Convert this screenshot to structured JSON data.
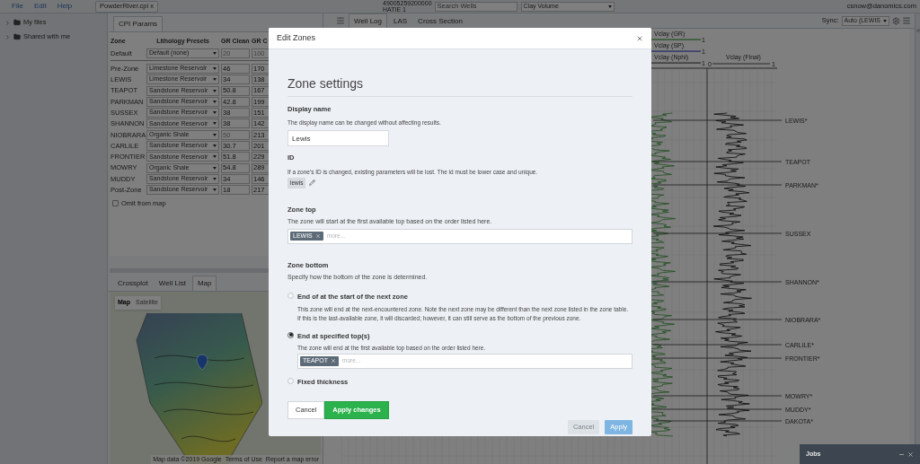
{
  "menu": [
    "File",
    "Edit",
    "Help"
  ],
  "file_tab": "PowderRiver.cpi x",
  "well": {
    "number": "49005259200000",
    "name": "HATIE 1"
  },
  "search": {
    "placeholder": "Search Wells"
  },
  "log_select": "Clay Volume",
  "user": "csnow@danomics.com",
  "sidebar": {
    "items": [
      {
        "label": "My files",
        "expanded": false
      },
      {
        "label": "Shared with me",
        "expanded": false
      }
    ]
  },
  "cpi_panel": {
    "tab": "CPI Params",
    "columns": [
      "Zone",
      "Lithology Presets",
      "GR Clean",
      "GR C"
    ],
    "default_row": {
      "zone": "Default",
      "preset": "Default (none)",
      "gr_clean": "20",
      "gr_clean_default": true,
      "gr_c": "100",
      "gr_c_default": true
    },
    "rows": [
      {
        "zone": "Pre-Zone",
        "preset": "Limestone Reservoir",
        "gr_clean": "46",
        "gr_clean_default": false,
        "gr_c": "170",
        "gr_c_default": false
      },
      {
        "zone": "LEWIS",
        "preset": "Limestone Reservoir",
        "gr_clean": "34",
        "gr_clean_default": false,
        "gr_c": "138",
        "gr_c_default": false
      },
      {
        "zone": "TEAPOT",
        "preset": "Sandstone Reservoir",
        "gr_clean": "50.8",
        "gr_clean_default": false,
        "gr_c": "167",
        "gr_c_default": false
      },
      {
        "zone": "PARKMAN",
        "preset": "Sandstone Reservoir",
        "gr_clean": "42.8",
        "gr_clean_default": false,
        "gr_c": "199",
        "gr_c_default": false
      },
      {
        "zone": "SUSSEX",
        "preset": "Sandstone Reservoir",
        "gr_clean": "38",
        "gr_clean_default": false,
        "gr_c": "151",
        "gr_c_default": false
      },
      {
        "zone": "SHANNON",
        "preset": "Sandstone Reservoir",
        "gr_clean": "38",
        "gr_clean_default": false,
        "gr_c": "142",
        "gr_c_default": false
      },
      {
        "zone": "NIOBRARA",
        "preset": "Organic Shale",
        "gr_clean": "50",
        "gr_clean_default": true,
        "gr_c": "213",
        "gr_c_default": false
      },
      {
        "zone": "CARLILE",
        "preset": "Sandstone Reservoir",
        "gr_clean": "30.7",
        "gr_clean_default": false,
        "gr_c": "201",
        "gr_c_default": false
      },
      {
        "zone": "FRONTIER",
        "preset": "Sandstone Reservoir",
        "gr_clean": "51.8",
        "gr_clean_default": false,
        "gr_c": "229",
        "gr_c_default": false
      },
      {
        "zone": "MOWRY",
        "preset": "Organic Shale",
        "gr_clean": "54.8",
        "gr_clean_default": false,
        "gr_c": "289",
        "gr_c_default": false
      },
      {
        "zone": "MUDDY",
        "preset": "Sandstone Reservoir",
        "gr_clean": "34",
        "gr_clean_default": false,
        "gr_c": "146",
        "gr_c_default": false
      },
      {
        "zone": "Post-Zone",
        "preset": "Sandstone Reservoir",
        "gr_clean": "18",
        "gr_clean_default": false,
        "gr_c": "217",
        "gr_c_default": false
      }
    ],
    "omit_from_map": {
      "label": "Omit from map",
      "checked": false
    }
  },
  "bottom_tabs": [
    {
      "label": "Crossplot",
      "selected": false
    },
    {
      "label": "Well List",
      "selected": false
    },
    {
      "label": "Map",
      "selected": true
    }
  ],
  "map": {
    "types": [
      {
        "label": "Map",
        "selected": true
      },
      {
        "label": "Satellite",
        "selected": false
      }
    ],
    "footer": [
      "Map data ©2019 Google",
      "Terms of Use",
      "Report a map error"
    ]
  },
  "view_tabs": [
    {
      "label": "Well Log",
      "selected": true
    },
    {
      "label": "LAS",
      "selected": false
    },
    {
      "label": "Cross Section",
      "selected": false
    }
  ],
  "sync": {
    "label": "Sync:",
    "value": "Auto (LEWIS"
  },
  "log": {
    "tracks": [
      {
        "label": "Vclay (GR)",
        "max": "1"
      },
      {
        "label": "Vclay (SP)",
        "max": "1"
      },
      {
        "label": "Vclay (Nphi)",
        "max": "1"
      }
    ],
    "final": {
      "label": "Vclay (Final)",
      "min": "0",
      "max": "1"
    },
    "tops": [
      {
        "label": "LEWIS*"
      },
      {
        "label": "TEAPOT"
      },
      {
        "label": "PARKMAN*"
      },
      {
        "label": "SUSSEX"
      },
      {
        "label": "SHANNON*"
      },
      {
        "label": "NIOBRARA*"
      },
      {
        "label": "CARLILE*"
      },
      {
        "label": "FRONTIER*"
      },
      {
        "label": "MOWRY*"
      },
      {
        "label": "MUDDY*"
      },
      {
        "label": "DAKOTA*"
      }
    ]
  },
  "jobs": {
    "title": "Jobs"
  },
  "dialog": {
    "title": "Edit Zones",
    "heading": "Zone settings",
    "display_name": {
      "label": "Display name",
      "help": "The display name can be changed without affecting results.",
      "value": "Lewis"
    },
    "id": {
      "label": "ID",
      "help": "If a zone's ID is changed, existing parameters will be lost. The id must be lower case and unique.",
      "value": "lewis"
    },
    "zone_top": {
      "label": "Zone top",
      "help": "The zone will start at the first available top based on the order listed here.",
      "tags": [
        "LEWIS"
      ],
      "placeholder": "more..."
    },
    "zone_bottom": {
      "label": "Zone bottom",
      "help": "Specify how the bottom of the zone is determined.",
      "options": [
        {
          "label": "End of at the start of the next zone",
          "description": "This zone will end at the next-encountered zone. Note the next zone may be different than the next zone listed in the zone table. If this is the last-available zone, it will discarded; however, it can still serve as the bottom of the previous zone.",
          "selected": false
        },
        {
          "label": "End at specified top(s)",
          "description": "The zone will end at the first available top based on the order listed here.",
          "selected": true,
          "tags": [
            "TEAPOT"
          ],
          "placeholder": "more..."
        },
        {
          "label": "Fixed thickness",
          "selected": false
        }
      ]
    },
    "actions": [
      {
        "label": "Cancel",
        "kind": "secondary"
      },
      {
        "label": "Apply changes",
        "kind": "primary"
      }
    ],
    "footer": [
      {
        "label": "Cancel",
        "kind": "secondary",
        "disabled": true
      },
      {
        "label": "Apply",
        "kind": "primary",
        "disabled": true
      }
    ]
  }
}
